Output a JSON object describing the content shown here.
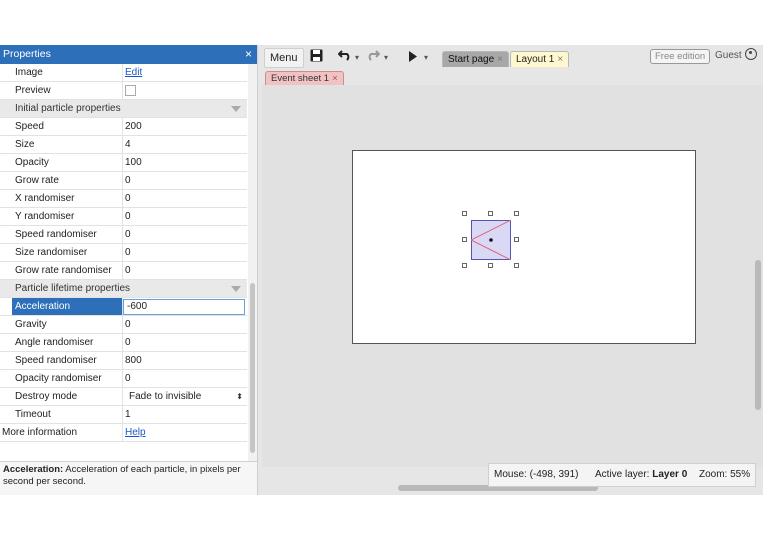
{
  "properties": {
    "title": "Properties",
    "close": "×",
    "rows": [
      {
        "key": "Image",
        "value": "Edit",
        "type": "link"
      },
      {
        "key": "Preview",
        "value": "",
        "type": "checkbox"
      },
      {
        "key": "Initial particle properties",
        "type": "category"
      },
      {
        "key": "Speed",
        "value": "200"
      },
      {
        "key": "Size",
        "value": "4"
      },
      {
        "key": "Opacity",
        "value": "100"
      },
      {
        "key": "Grow rate",
        "value": "0"
      },
      {
        "key": "X randomiser",
        "value": "0"
      },
      {
        "key": "Y randomiser",
        "value": "0"
      },
      {
        "key": "Speed randomiser",
        "value": "0"
      },
      {
        "key": "Size randomiser",
        "value": "0"
      },
      {
        "key": "Grow rate randomiser",
        "value": "0"
      },
      {
        "key": "Particle lifetime properties",
        "type": "category"
      },
      {
        "key": "Acceleration",
        "value": "-600",
        "type": "input",
        "selected": true
      },
      {
        "key": "Gravity",
        "value": "0"
      },
      {
        "key": "Angle randomiser",
        "value": "0"
      },
      {
        "key": "Speed randomiser",
        "value": "800"
      },
      {
        "key": "Opacity randomiser",
        "value": "0"
      },
      {
        "key": "Destroy mode",
        "value": "Fade to invisible",
        "type": "select"
      },
      {
        "key": "Timeout",
        "value": "1"
      },
      {
        "key": "More information",
        "value": "Help",
        "type": "link",
        "full": true
      }
    ],
    "description": {
      "label": "Acceleration:",
      "text": " Acceleration of each particle, in pixels per second per second."
    }
  },
  "toolbar": {
    "menu_label": "Menu",
    "save_icon": "floppy-icon",
    "undo_icon": "undo-icon",
    "redo_icon": "redo-icon",
    "play_icon": "play-icon",
    "tabs": [
      {
        "label": "Start page",
        "close": "×"
      },
      {
        "label": "Layout 1",
        "close": "×"
      }
    ],
    "free_edition": "Free edition",
    "guest": "Guest"
  },
  "subtab": {
    "label": "Event sheet 1",
    "close": "×"
  },
  "status": {
    "mouse_label": "Mouse: (-498, 391)",
    "layer_prefix": "Active layer: ",
    "layer_value": "Layer 0",
    "zoom_label": "Zoom: 55%"
  },
  "colors": {
    "title_bar": "#2d6fb8",
    "selected_row": "#2d6fb8",
    "layout_tab": "#fff8cf",
    "event_tab": "#f0c2c2",
    "particle_fill": "#d9d9f5",
    "particle_lines": "#e0607a"
  }
}
